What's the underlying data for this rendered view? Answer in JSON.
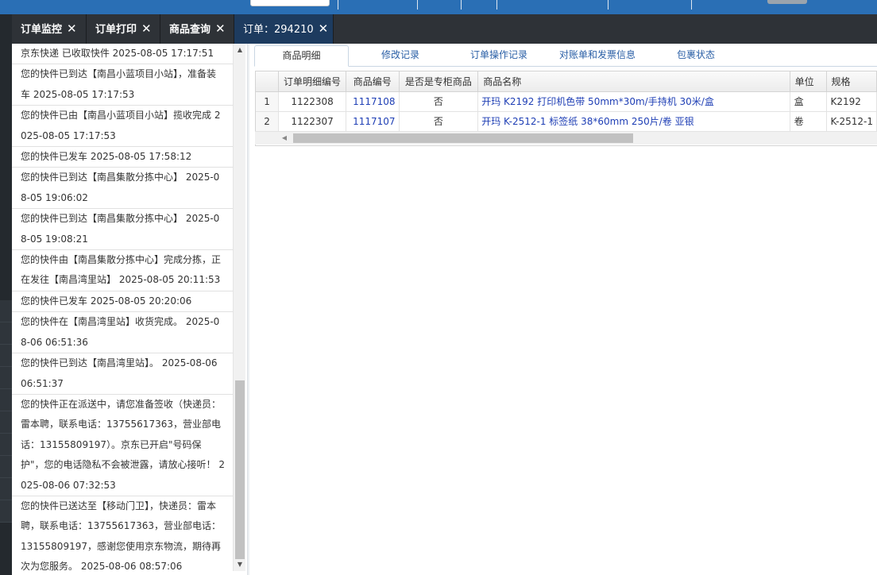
{
  "tabs": [
    {
      "label": "订单监控"
    },
    {
      "label": "订单打印"
    },
    {
      "label": "商品查询"
    },
    {
      "label": "订单：294210"
    }
  ],
  "tracking": [
    "京东快递 已收取快件 2025-08-05 17:17:51",
    "您的快件已到达【南昌小蓝项目小站】，准备装车 2025-08-05 17:17:53",
    "您的快件已由【南昌小蓝项目小站】揽收完成 2025-08-05 17:17:53",
    "您的快件已发车 2025-08-05 17:58:12",
    "您的快件已到达【南昌集散分拣中心】 2025-08-05 19:06:02",
    "您的快件已到达【南昌集散分拣中心】 2025-08-05 19:08:21",
    "您的快件由【南昌集散分拣中心】完成分拣，正在发往【南昌湾里站】 2025-08-05 20:11:53",
    "您的快件已发车 2025-08-05 20:20:06",
    "您的快件在【南昌湾里站】收货完成。 2025-08-06 06:51:36",
    "您的快件已到达【南昌湾里站】。 2025-08-06 06:51:37",
    "您的快件正在派送中，请您准备签收（快递员：雷本聘，联系电话：13755617363，营业部电话：13155809197）。京东已开启\"号码保护\"，您的电话隐私不会被泄露，请放心接听！ 2025-08-06 07:32:53",
    "您的快件已送达至【移动门卫】，快递员：雷本聘，联系电话：13755617363，营业部电话：13155809197，感谢您使用京东物流，期待再次为您服务。 2025-08-06 08:57:06"
  ],
  "subtabs": [
    {
      "label": "商品明细"
    },
    {
      "label": "修改记录"
    },
    {
      "label": "订单操作记录"
    },
    {
      "label": "对账单和发票信息"
    },
    {
      "label": "包裹状态"
    }
  ],
  "grid": {
    "headers": [
      "",
      "订单明细编号",
      "商品编号",
      "是否是专柜商品",
      "商品名称",
      "单位",
      "规格"
    ],
    "rows": [
      [
        "1",
        "1122308",
        "1117108",
        "否",
        "开玛 K2192 打印机色带 50mm*30m/手持机 30米/盒",
        "盒",
        "K2192"
      ],
      [
        "2",
        "1122307",
        "1117107",
        "否",
        "开玛 K-2512-1 标签纸 38*60mm 250片/卷 亚银",
        "卷",
        "K-2512-1"
      ]
    ]
  },
  "colors": {
    "topbar": "#2a6fb5",
    "tabbar": "#2e3237",
    "active_tab": "#1d3b5f",
    "link": "#1f3fb5"
  },
  "icons": {
    "tab_close": "close-icon",
    "scroll_up": "chevron-up-icon",
    "scroll_down": "chevron-down-icon",
    "scroll_left": "chevron-left-icon"
  }
}
